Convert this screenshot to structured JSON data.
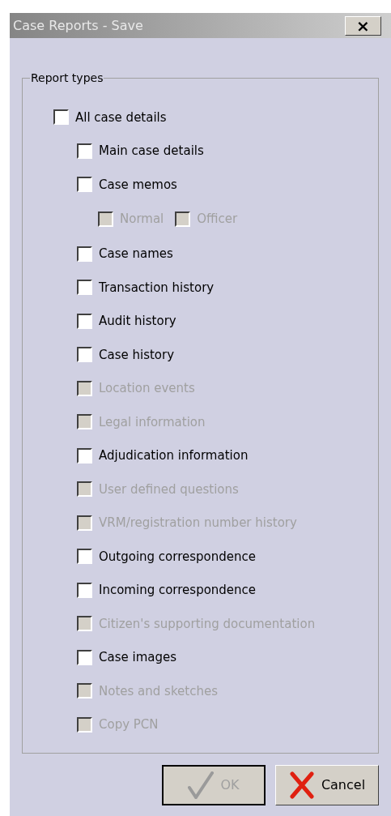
{
  "window": {
    "title": "Case Reports - Save",
    "close": "×"
  },
  "group": {
    "label": "Report types",
    "items": [
      {
        "label": "All case details",
        "checked": false,
        "disabled": false,
        "children": [
          {
            "label": "Main case details",
            "checked": false,
            "disabled": false
          },
          {
            "label": "Case memos",
            "checked": false,
            "disabled": false,
            "children": [
              {
                "label": "Normal",
                "checked": false,
                "disabled": true
              },
              {
                "label": "Officer",
                "checked": false,
                "disabled": true
              }
            ]
          },
          {
            "label": "Case names",
            "checked": false,
            "disabled": false
          },
          {
            "label": "Transaction history",
            "checked": false,
            "disabled": false
          },
          {
            "label": "Audit history",
            "checked": false,
            "disabled": false
          },
          {
            "label": "Case history",
            "checked": false,
            "disabled": false
          },
          {
            "label": "Location events",
            "checked": false,
            "disabled": true
          },
          {
            "label": "Legal information",
            "checked": false,
            "disabled": true
          },
          {
            "label": "Adjudication information",
            "checked": false,
            "disabled": false
          },
          {
            "label": "User defined questions",
            "checked": false,
            "disabled": true
          },
          {
            "label": "VRM/registration number history",
            "checked": false,
            "disabled": true
          },
          {
            "label": "Outgoing correspondence",
            "checked": false,
            "disabled": false
          },
          {
            "label": "Incoming correspondence",
            "checked": false,
            "disabled": false
          },
          {
            "label": "Citizen's supporting documentation",
            "checked": false,
            "disabled": true
          },
          {
            "label": "Case images",
            "checked": false,
            "disabled": false
          },
          {
            "label": "Notes and sketches",
            "checked": false,
            "disabled": true
          },
          {
            "label": "Copy PCN",
            "checked": false,
            "disabled": true
          }
        ]
      }
    ]
  },
  "buttons": [
    {
      "label": "OK",
      "kind": "ok",
      "disabled": true
    },
    {
      "label": "Cancel",
      "kind": "cancel",
      "disabled": false
    }
  ]
}
